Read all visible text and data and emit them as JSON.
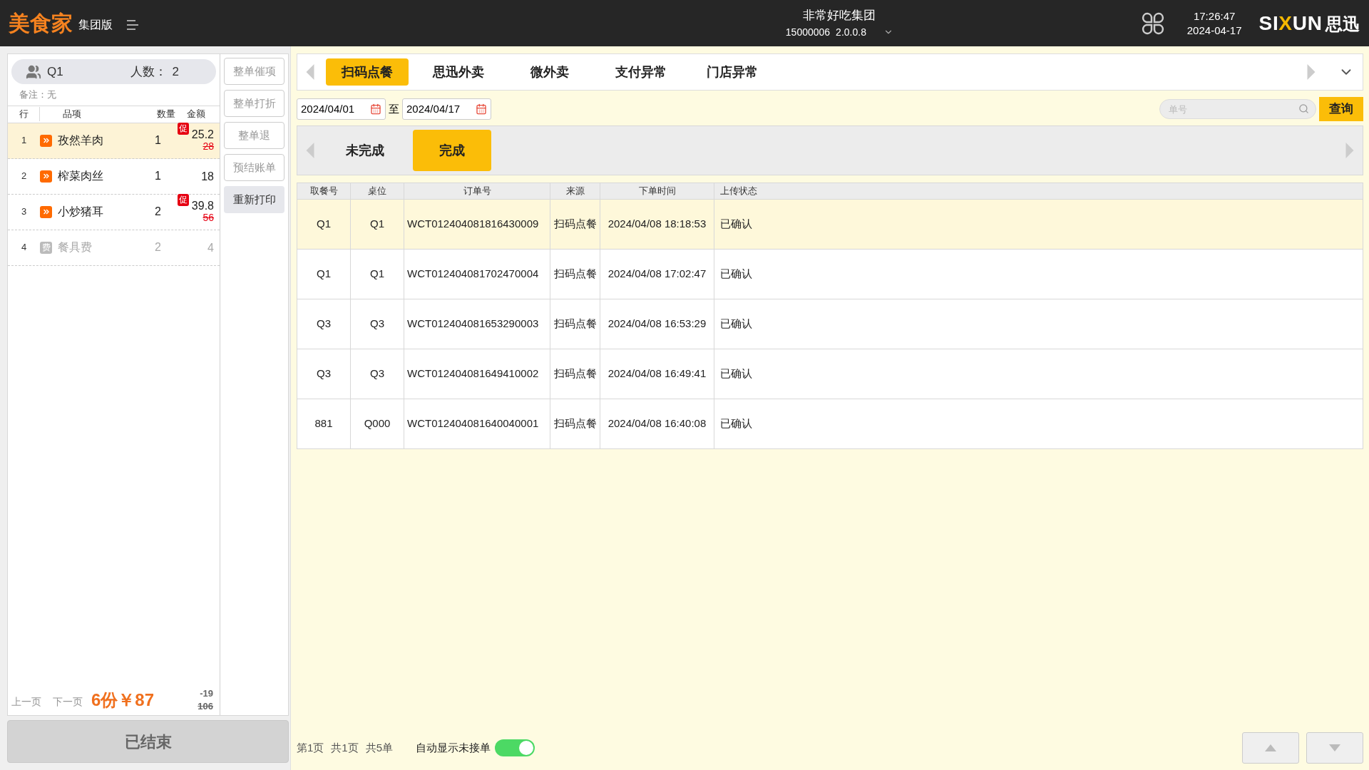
{
  "header": {
    "brand": "美食家",
    "edition": "集团版",
    "group": "非常好吃集团",
    "store_id": "15000006",
    "version": "2.0.0.8",
    "time": "17:26:47",
    "date": "2024-04-17",
    "logo": {
      "lead": "SI",
      "accent": "X",
      "tail": "UN",
      "cn": "思迅"
    }
  },
  "order": {
    "table_no": "Q1",
    "guests_label": "人数：",
    "guests": "2",
    "remark": "备注：无",
    "columns": [
      "行",
      "品项",
      "数量",
      "金额"
    ],
    "items": [
      {
        "row": "1",
        "kind": "dish",
        "name": "孜然羊肉",
        "qty": "1",
        "amount": "25.2",
        "original": "28",
        "promo": "促",
        "selected": true,
        "disabled": false
      },
      {
        "row": "2",
        "kind": "dish",
        "name": "榨菜肉丝",
        "qty": "1",
        "amount": "18",
        "selected": false,
        "disabled": false
      },
      {
        "row": "3",
        "kind": "dish",
        "name": "小炒猪耳",
        "qty": "2",
        "amount": "39.8",
        "original": "56",
        "promo": "促",
        "selected": false,
        "disabled": false
      },
      {
        "row": "4",
        "kind": "fee",
        "badge": "费",
        "name": "餐具费",
        "qty": "2",
        "amount": "4",
        "selected": false,
        "disabled": true
      }
    ],
    "prev": "上一页",
    "next": "下一页",
    "summary": "6份￥87",
    "discount": "-19",
    "original_total": "106"
  },
  "side_buttons": [
    {
      "label": "整单催项",
      "disabled": true
    },
    {
      "label": "整单打折",
      "disabled": true
    },
    {
      "label": "整单退",
      "disabled": true
    },
    {
      "label": "预结账单",
      "disabled": true
    },
    {
      "label": "重新打印",
      "disabled": false
    }
  ],
  "finish_button": "已结束",
  "channel_tabs": [
    {
      "label": "扫码点餐",
      "selected": true
    },
    {
      "label": "思迅外卖",
      "selected": false
    },
    {
      "label": "微外卖",
      "selected": false
    },
    {
      "label": "支付异常",
      "selected": false
    },
    {
      "label": "门店异常",
      "selected": false
    }
  ],
  "filter": {
    "date_from": "2024/04/01",
    "separator": "至",
    "date_to": "2024/04/17",
    "search_placeholder": "单号",
    "query_button": "查询"
  },
  "status_tabs": [
    {
      "label": "未完成",
      "selected": false
    },
    {
      "label": "完成",
      "selected": true
    }
  ],
  "table": {
    "columns": [
      "取餐号",
      "桌位",
      "订单号",
      "来源",
      "下单时间",
      "上传状态"
    ],
    "rows": [
      {
        "selected": true,
        "cells": [
          "Q1",
          "Q1",
          "WCT012404081816430009",
          "扫码点餐",
          "2024/04/08 18:18:53",
          "已确认"
        ]
      },
      {
        "selected": false,
        "cells": [
          "Q1",
          "Q1",
          "WCT012404081702470004",
          "扫码点餐",
          "2024/04/08 17:02:47",
          "已确认"
        ]
      },
      {
        "selected": false,
        "cells": [
          "Q3",
          "Q3",
          "WCT012404081653290003",
          "扫码点餐",
          "2024/04/08 16:53:29",
          "已确认"
        ]
      },
      {
        "selected": false,
        "cells": [
          "Q3",
          "Q3",
          "WCT012404081649410002",
          "扫码点餐",
          "2024/04/08 16:49:41",
          "已确认"
        ]
      },
      {
        "selected": false,
        "cells": [
          "881",
          "Q000",
          "WCT012404081640040001",
          "扫码点餐",
          "2024/04/08 16:40:08",
          "已确认"
        ]
      }
    ]
  },
  "footer": {
    "page": "第1页",
    "pages": "共1页",
    "count": "共5单",
    "auto_label": "自动显示未接单",
    "auto_on": true
  }
}
